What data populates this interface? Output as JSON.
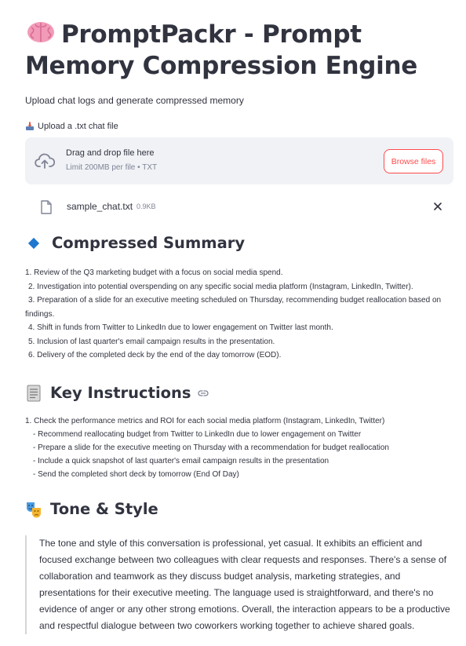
{
  "app": {
    "title": "PromptPackr - Prompt Memory Compression Engine",
    "title_icon": "brain-icon",
    "subtitle": "Upload chat logs and generate compressed memory"
  },
  "uploader": {
    "label": "Upload a .txt chat file",
    "drop_title": "Drag and drop file here",
    "limit": "Limit 200MB per file • TXT",
    "browse_label": "Browse files",
    "file_name": "sample_chat.txt",
    "file_size": "0.9KB"
  },
  "summary": {
    "heading": "Compressed Summary",
    "items": [
      "1. Review of the Q3 marketing budget with a focus on social media spend.",
      "2. Investigation into potential overspending on any specific social media platform (Instagram, LinkedIn, Twitter).",
      "3. Preparation of a slide for an executive meeting scheduled on Thursday, recommending budget reallocation based on",
      "findings.",
      "4. Shift in funds from Twitter to LinkedIn due to lower engagement on Twitter last month.",
      "5. Inclusion of last quarter's email campaign results in the presentation.",
      "6. Delivery of the completed deck by the end of the day tomorrow (EOD)."
    ]
  },
  "key_instructions": {
    "heading": "Key Instructions",
    "items": [
      "1. Check the performance metrics and ROI for each social media platform (Instagram, LinkedIn, Twitter)",
      "- Recommend reallocating budget from Twitter to LinkedIn due to lower engagement on Twitter",
      "- Prepare a slide for the executive meeting on Thursday with a recommendation for budget reallocation",
      "- Include a quick snapshot of last quarter's email campaign results in the presentation",
      "- Send the completed short deck by tomorrow (End Of Day)"
    ]
  },
  "tone": {
    "heading": "Tone & Style",
    "text": "The tone and style of this conversation is professional, yet casual. It exhibits an efficient and focused exchange between two colleagues with clear requests and responses. There's a sense of collaboration and teamwork as they discuss budget analysis, marketing strategies, and presentations for their executive meeting. The language used is straightforward, and there's no evidence of anger or any other strong emotions. Overall, the interaction appears to be a productive and respectful dialogue between two coworkers working together to achieve shared goals."
  },
  "colors": {
    "accent": "#ff4b4b",
    "text": "#31333f",
    "muted": "#808495",
    "dropzone_bg": "#f0f2f6",
    "diamond": "#1f77d0"
  }
}
